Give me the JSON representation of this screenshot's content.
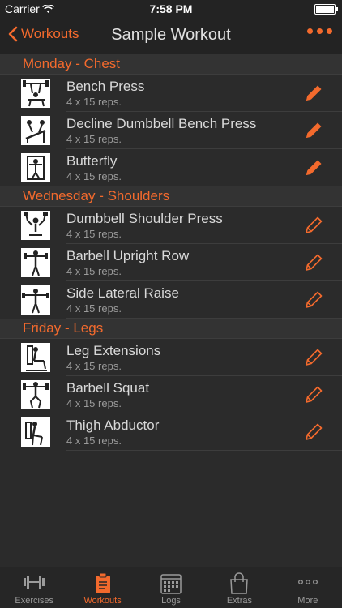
{
  "status": {
    "carrier": "Carrier",
    "time": "7:58 PM"
  },
  "nav": {
    "back_label": "Workouts",
    "title": "Sample Workout"
  },
  "sections": [
    {
      "title": "Monday - Chest",
      "exercises": [
        {
          "name": "Bench Press",
          "reps": "4 x 15 reps."
        },
        {
          "name": "Decline Dumbbell Bench Press",
          "reps": "4 x 15 reps."
        },
        {
          "name": "Butterfly",
          "reps": "4 x 15 reps."
        }
      ]
    },
    {
      "title": "Wednesday - Shoulders",
      "exercises": [
        {
          "name": "Dumbbell Shoulder Press",
          "reps": "4 x 15 reps."
        },
        {
          "name": "Barbell Upright Row",
          "reps": "4 x 15 reps."
        },
        {
          "name": "Side Lateral Raise",
          "reps": "4 x 15 reps."
        }
      ]
    },
    {
      "title": "Friday - Legs",
      "exercises": [
        {
          "name": "Leg Extensions",
          "reps": "4 x 15 reps."
        },
        {
          "name": "Barbell Squat",
          "reps": "4 x 15 reps."
        },
        {
          "name": "Thigh Abductor",
          "reps": "4 x 15 reps."
        }
      ]
    }
  ],
  "tabs": [
    {
      "label": "Exercises",
      "icon": "dumbbell-icon"
    },
    {
      "label": "Workouts",
      "icon": "clipboard-icon"
    },
    {
      "label": "Logs",
      "icon": "calendar-icon"
    },
    {
      "label": "Extras",
      "icon": "bag-icon"
    },
    {
      "label": "More",
      "icon": "more-icon"
    }
  ],
  "colors": {
    "accent": "#f36a2d",
    "background": "#2b2b2b",
    "bar": "#232323"
  }
}
